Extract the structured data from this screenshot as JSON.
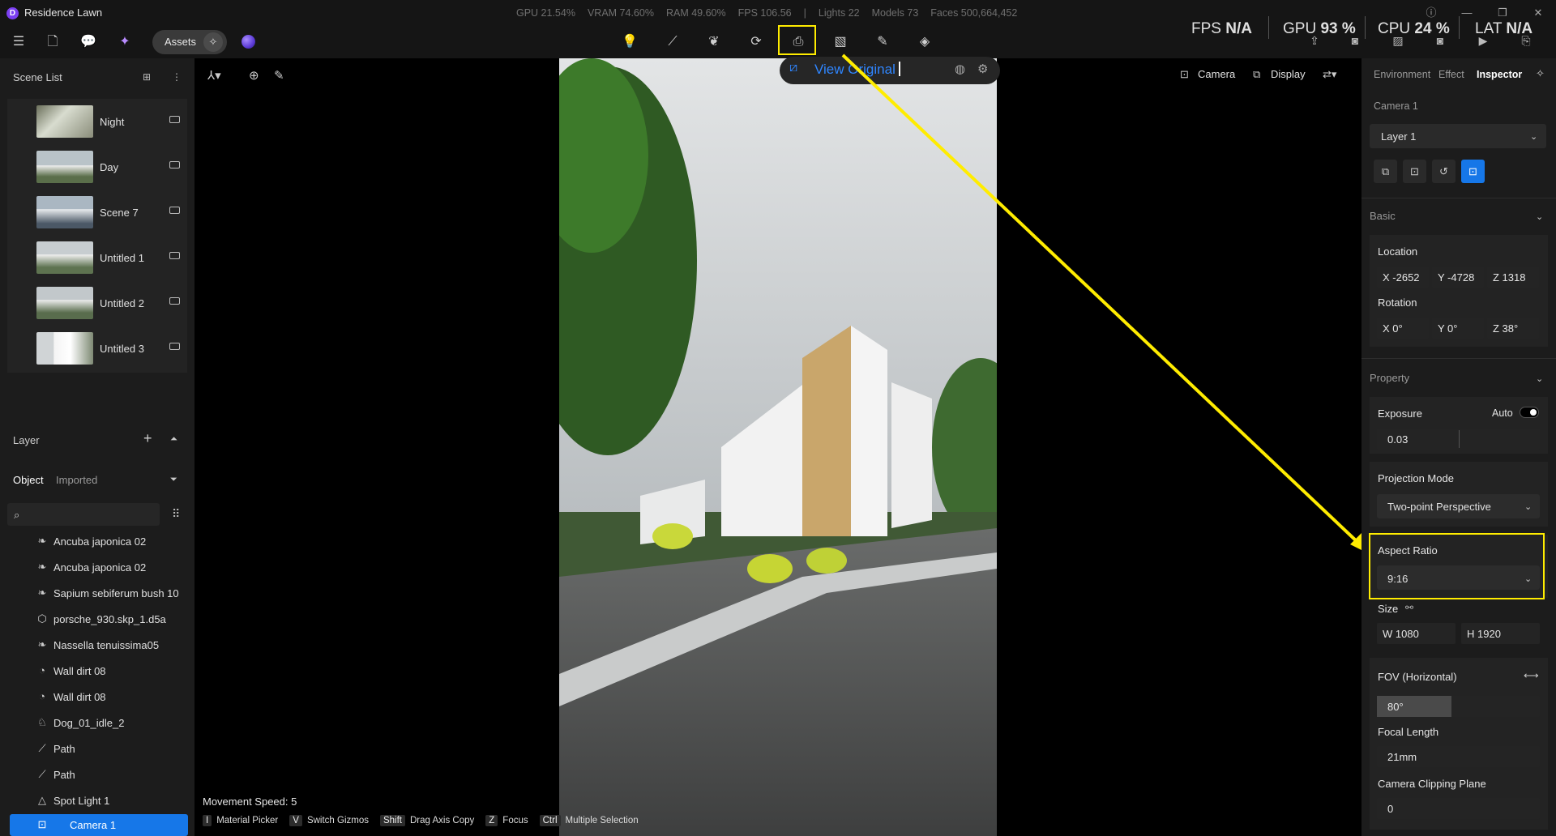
{
  "app": {
    "title": "Residence Lawn",
    "logo_letter": "D"
  },
  "stats": [
    "GPU 21.54%",
    "VRAM 74.60%",
    "RAM 49.60%",
    "FPS 106.56",
    "|",
    "Lights 22",
    "Models 73",
    "Faces 500,664,452"
  ],
  "toolbar": {
    "assets_label": "Assets"
  },
  "perf": {
    "fps_label": "FPS",
    "fps_value": "N/A",
    "gpu_label": "GPU",
    "gpu_value": "93 %",
    "cpu_label": "CPU",
    "cpu_value": "24 %",
    "lat_label": "LAT",
    "lat_value": "N/A"
  },
  "scene_list": {
    "title": "Scene List",
    "items": [
      {
        "label": "Night"
      },
      {
        "label": "Day"
      },
      {
        "label": "Scene 7"
      },
      {
        "label": "Untitled 1"
      },
      {
        "label": "Untitled 2"
      },
      {
        "label": "Untitled 3"
      }
    ]
  },
  "layer": {
    "title": "Layer",
    "tabs": [
      "Object",
      "Imported"
    ],
    "objects": [
      {
        "label": "Ancuba japonica 02",
        "icon": "leaf-icon"
      },
      {
        "label": "Ancuba japonica 02",
        "icon": "leaf-icon"
      },
      {
        "label": "Sapium sebiferum bush 10",
        "icon": "leaf-icon"
      },
      {
        "label": "porsche_930.skp_1.d5a",
        "icon": "cube-icon"
      },
      {
        "label": "Nassella tenuissima05",
        "icon": "leaf-icon"
      },
      {
        "label": "Wall dirt 08",
        "icon": "decal-icon"
      },
      {
        "label": "Wall dirt 08",
        "icon": "decal-icon"
      },
      {
        "label": "Dog_01_idle_2",
        "icon": "animal-icon"
      },
      {
        "label": "Path",
        "icon": "path-icon"
      },
      {
        "label": "Path",
        "icon": "path-icon"
      },
      {
        "label": "Spot Light 1",
        "icon": "spotlight-icon"
      },
      {
        "label": "Camera 1",
        "icon": "camera-icon"
      }
    ]
  },
  "viewport": {
    "view_original": "View Original",
    "camera_label": "Camera",
    "display_label": "Display",
    "movement_speed": "Movement Speed: 5",
    "shortcuts": [
      {
        "key": "I",
        "text": "Material Picker"
      },
      {
        "key": "V",
        "text": "Switch Gizmos"
      },
      {
        "key": "Shift",
        "text": "Drag Axis Copy"
      },
      {
        "key": "Z",
        "text": "Focus"
      },
      {
        "key": "Ctrl",
        "text": "Multiple Selection"
      }
    ]
  },
  "inspector": {
    "tabs": [
      "Environment",
      "Effect",
      "Inspector"
    ],
    "camera_name": "Camera 1",
    "layer_select": "Layer 1",
    "basic_title": "Basic",
    "location_label": "Location",
    "location": {
      "x": "X  -2652",
      "y": "Y  -4728",
      "z": "Z  1318"
    },
    "rotation_label": "Rotation",
    "rotation": {
      "x": "X  0°",
      "y": "Y  0°",
      "z": "Z  38°"
    },
    "property_title": "Property",
    "exposure_label": "Exposure",
    "auto_label": "Auto",
    "exposure_value": "0.03",
    "projection_label": "Projection Mode",
    "projection_value": "Two-point Perspective",
    "aspect_label": "Aspect Ratio",
    "aspect_value": "9:16",
    "size_label": "Size",
    "size_w": "W  1080",
    "size_h": "H  1920",
    "fov_label": "FOV (Horizontal)",
    "fov_value": "80°",
    "focal_label": "Focal Length",
    "focal_value": "21mm",
    "clip_label": "Camera Clipping Plane",
    "clip_value": "0"
  },
  "colors": {
    "accent": "#1677e8",
    "highlight": "#ffec00",
    "link": "#2f86ff"
  }
}
